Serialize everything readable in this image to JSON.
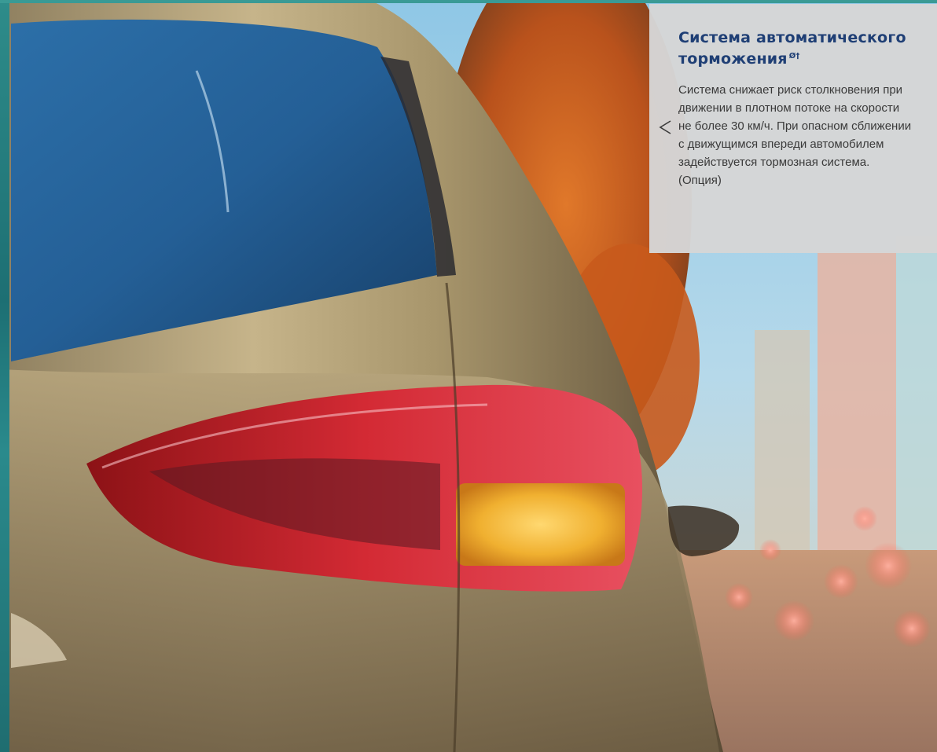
{
  "info_panel": {
    "title": "Система автоматического торможения",
    "title_footnote": "Ø†",
    "body_lines": [
      "Система снижает риск столкновения при",
      "движении в плотном потоке на скорости",
      "не более 30 км/ч. При опасном сближении",
      "с движущимся впереди автомобилем",
      "задействуется тормозная система.",
      "(Опция)"
    ],
    "pointer_icon": "chevron-left-icon",
    "colors": {
      "title": "#1f3f75",
      "body": "#3a3a3a",
      "background": "#d6d6d6"
    }
  },
  "photo": {
    "accent_colors": {
      "car_paint": "#b8a67a",
      "tail_light_red": "#c8202a",
      "turn_signal_amber": "#f0b030",
      "sky": "#8fc7e6",
      "trees": "#c8581e"
    }
  }
}
